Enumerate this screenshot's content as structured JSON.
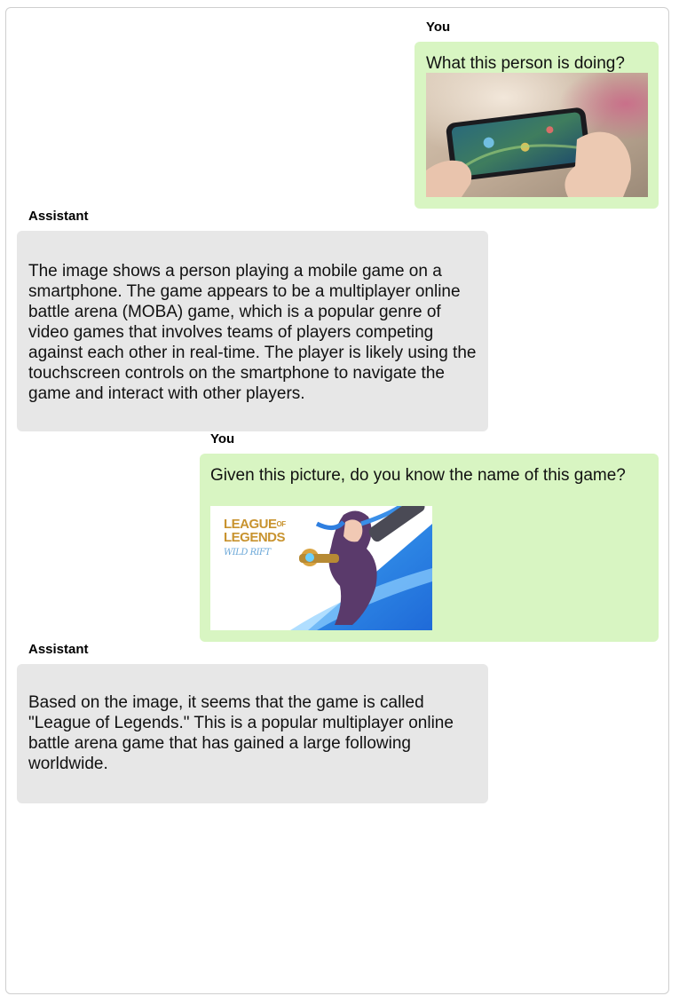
{
  "messages": [
    {
      "role": "user",
      "sender": "You",
      "text": "What this person is doing?",
      "image_desc": "hands-holding-phone-playing-moba"
    },
    {
      "role": "assistant",
      "sender": "Assistant",
      "text": "The image shows a person playing a mobile game on a smartphone. The game appears to be a multiplayer online battle arena (MOBA) game, which is a popular genre of video games that involves teams of players competing against each other in real-time. The player is likely using the touchscreen controls on the smartphone to navigate the game and interact with other players."
    },
    {
      "role": "user",
      "sender": "You",
      "text": "Given this picture, do you know the name of this game?",
      "image_desc": "league-of-legends-wild-rift-key-art",
      "logo_line1": "LEAGUE",
      "logo_of": "OF",
      "logo_line2": "LEGENDS",
      "logo_sub": "WILD RIFT"
    },
    {
      "role": "assistant",
      "sender": "Assistant",
      "text": "Based on the image, it seems that the game is called \"League of Legends.\" This is a popular multiplayer online battle arena game that has gained a large following worldwide."
    }
  ],
  "colors": {
    "user_bubble": "#d8f5c2",
    "assistant_bubble": "#e7e7e7",
    "frame_border": "#cfcfcf"
  }
}
